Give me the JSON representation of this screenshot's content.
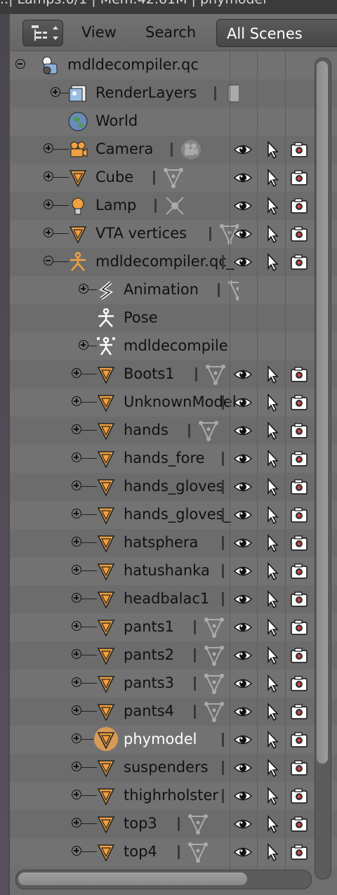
{
  "top_strip": "...| Lamps:0/1 | Mem:42.61M | phymodel",
  "header": {
    "view_menu": "View",
    "search_menu": "Search",
    "display_mode": "All Scenes"
  },
  "rows": [
    {
      "label": "mdldecompiler.qc",
      "icon": "scene-icon",
      "exp": "minus"
    },
    {
      "label": "RenderLayers",
      "icon": "renderlayers-icon",
      "exp": "plus"
    },
    {
      "label": "World",
      "icon": "world-icon",
      "exp": ""
    },
    {
      "label": "Camera",
      "icon": "camera-object-icon",
      "exp": "plus"
    },
    {
      "label": "Cube",
      "icon": "mesh-object-icon",
      "exp": "plus"
    },
    {
      "label": "Lamp",
      "icon": "lamp-object-icon",
      "exp": "plus"
    },
    {
      "label": "VTA vertices",
      "icon": "mesh-object-icon",
      "exp": "plus"
    },
    {
      "label": "mdldecompiler.qc_",
      "icon": "armature-object-icon",
      "exp": "minus"
    },
    {
      "label": "Animation",
      "icon": "animation-icon",
      "exp": "plus"
    },
    {
      "label": "Pose",
      "icon": "pose-icon",
      "exp": ""
    },
    {
      "label": "mdldecompile",
      "icon": "armature-data-icon",
      "exp": "plus"
    },
    {
      "label": "Boots1",
      "icon": "mesh-object-icon",
      "exp": "plus"
    },
    {
      "label": "UnknownModel",
      "icon": "mesh-object-icon",
      "exp": "plus"
    },
    {
      "label": "hands",
      "icon": "mesh-object-icon",
      "exp": "plus"
    },
    {
      "label": "hands_fore",
      "icon": "mesh-object-icon",
      "exp": "plus"
    },
    {
      "label": "hands_gloves",
      "icon": "mesh-object-icon",
      "exp": "plus"
    },
    {
      "label": "hands_gloves_",
      "icon": "mesh-object-icon",
      "exp": "plus"
    },
    {
      "label": "hatsphera",
      "icon": "mesh-object-icon",
      "exp": "plus"
    },
    {
      "label": "hatushanka",
      "icon": "mesh-object-icon",
      "exp": "plus"
    },
    {
      "label": "headbalac1",
      "icon": "mesh-object-icon",
      "exp": "plus"
    },
    {
      "label": "pants1",
      "icon": "mesh-object-icon",
      "exp": "plus"
    },
    {
      "label": "pants2",
      "icon": "mesh-object-icon",
      "exp": "plus"
    },
    {
      "label": "pants3",
      "icon": "mesh-object-icon",
      "exp": "plus"
    },
    {
      "label": "pants4",
      "icon": "mesh-object-icon",
      "exp": "plus"
    },
    {
      "label": "phymodel",
      "icon": "mesh-object-icon",
      "exp": "plus",
      "selected": true
    },
    {
      "label": "suspenders",
      "icon": "mesh-object-icon",
      "exp": "plus"
    },
    {
      "label": "thighrholster",
      "icon": "mesh-object-icon",
      "exp": "plus"
    },
    {
      "label": "top3",
      "icon": "mesh-object-icon",
      "exp": "plus"
    },
    {
      "label": "top4",
      "icon": "mesh-object-icon",
      "exp": "plus"
    }
  ],
  "colors": {
    "editor_bg": "#6e6e6e",
    "object_orange": "#f0a040",
    "selection_highlight": "#d99a55",
    "text": "#111111",
    "selected_text": "#ffffff"
  }
}
